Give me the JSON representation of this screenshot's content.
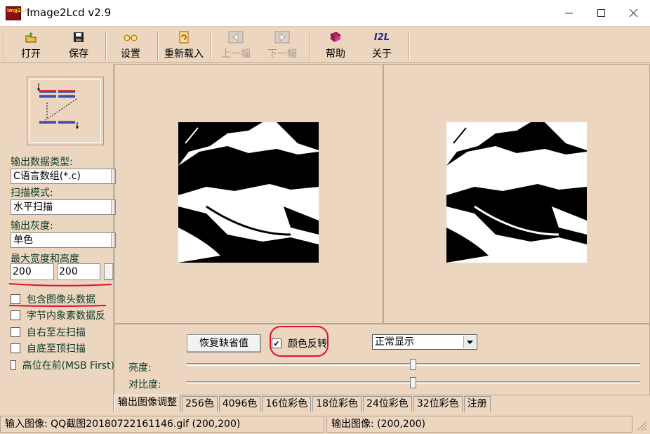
{
  "window": {
    "title": "Image2Lcd v2.9",
    "icon_text": "Img2Lcd"
  },
  "toolbar": {
    "open": "打开",
    "save": "保存",
    "settings": "设置",
    "reload": "重新载入",
    "prev": "上一幅",
    "next": "下一幅",
    "help": "帮助",
    "about": "关于",
    "about_icon_text": "I2L"
  },
  "left": {
    "output_type_label": "输出数据类型:",
    "output_type_value": "C语言数组(*.c)",
    "scan_mode_label": "扫描模式:",
    "scan_mode_value": "水平扫描",
    "gray_label": "输出灰度:",
    "gray_value": "单色",
    "max_size_label": "最大宽度和高度",
    "max_width": "200",
    "max_height": "200",
    "checkboxes": [
      {
        "label": "包含图像头数据",
        "checked": false
      },
      {
        "label": "字节内象素数据反",
        "checked": false
      },
      {
        "label": "自右至左扫描",
        "checked": false
      },
      {
        "label": "自底至顶扫描",
        "checked": false
      },
      {
        "label": "高位在前(MSB First)",
        "checked": false
      }
    ]
  },
  "adjust": {
    "restore_button": "恢复缺省值",
    "invert_label": "颜色反转",
    "invert_checked": "✔",
    "display_mode": "正常显示",
    "brightness_label": "亮度:",
    "brightness_level": 0.5,
    "contrast_label": "对比度:",
    "contrast_level": 0.5
  },
  "tabs": [
    "输出图像调整",
    "256色",
    "4096色",
    "16位彩色",
    "18位彩色",
    "24位彩色",
    "32位彩色",
    "注册"
  ],
  "status": {
    "input": "输入图像: QQ截图20180722161146.gif (200,200)",
    "output": "输出图像: (200,200)"
  },
  "colors": {
    "background": "#ecd6c0",
    "annotation": "#e0102a"
  }
}
